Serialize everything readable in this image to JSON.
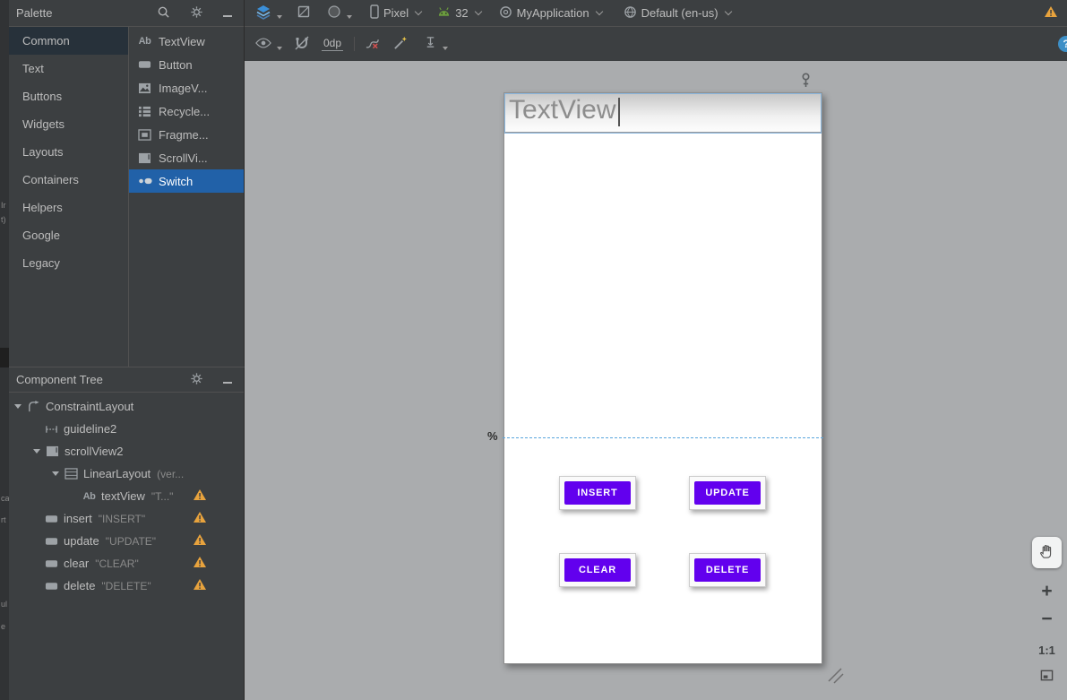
{
  "left_bar": {
    "fragments": [
      "Ir",
      "t)",
      "ca",
      "rt",
      "ul",
      "e"
    ]
  },
  "palette": {
    "title": "Palette",
    "categories": [
      "Common",
      "Text",
      "Buttons",
      "Widgets",
      "Layouts",
      "Containers",
      "Helpers",
      "Google",
      "Legacy"
    ],
    "items": [
      "TextView",
      "Button",
      "ImageV...",
      "Recycle...",
      "Fragme...",
      "ScrollVi...",
      "Switch"
    ],
    "textview_icon_label": "Ab"
  },
  "toolbar": {
    "device": "Pixel",
    "api_level": "32",
    "app_theme": "MyApplication",
    "locale": "Default (en-us)",
    "default_margin": "0dp",
    "help": "?"
  },
  "component_tree": {
    "title": "Component Tree",
    "nodes": [
      {
        "label": "ConstraintLayout",
        "suffix": ""
      },
      {
        "label": "guideline2",
        "suffix": ""
      },
      {
        "label": "scrollView2",
        "suffix": ""
      },
      {
        "label": "LinearLayout",
        "suffix": "(ver..."
      },
      {
        "label": "textView",
        "suffix": "\"T...\""
      },
      {
        "label": "insert",
        "suffix": "\"INSERT\""
      },
      {
        "label": "update",
        "suffix": "\"UPDATE\""
      },
      {
        "label": "clear",
        "suffix": "\"CLEAR\""
      },
      {
        "label": "delete",
        "suffix": "\"DELETE\""
      }
    ]
  },
  "canvas": {
    "textview_text": "TextView",
    "buttons": [
      "INSERT",
      "UPDATE",
      "CLEAR",
      "DELETE"
    ],
    "guideline_marker": "%",
    "zoom_in": "+",
    "zoom_out": "−",
    "zoom_level": "1:1"
  },
  "colors": {
    "button_purple": "#6200ee",
    "selection_blue": "#2161a8",
    "warning_orange": "#e8a33d",
    "canvas_gray": "#aaacae"
  }
}
